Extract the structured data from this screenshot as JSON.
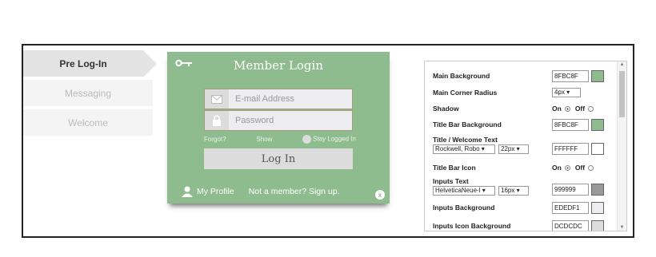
{
  "tabs": [
    {
      "label": "Pre Log-In",
      "active": true
    },
    {
      "label": "Messaging",
      "active": false
    },
    {
      "label": "Welcome",
      "active": false
    }
  ],
  "login": {
    "title": "Member Login",
    "email_placeholder": "E-mail Address",
    "password_placeholder": "Password",
    "forgot": "Forgot?",
    "show": "Show",
    "stay": "Stay Logged In",
    "button": "Log In",
    "profile": "My Profile",
    "signup": "Not a member? Sign up.",
    "close": "x",
    "colors": {
      "background": "#8FBC8F"
    }
  },
  "settings": {
    "main_bg": {
      "label": "Main Background",
      "hex": "8FBC8F",
      "color": "#8FBC8F"
    },
    "corner": {
      "label": "Main Corner Radius",
      "value": "4px"
    },
    "shadow": {
      "label": "Shadow",
      "on": "On",
      "off": "Off",
      "selected": "On"
    },
    "title_bg": {
      "label": "Title Bar Background",
      "hex": "8FBC8F",
      "color": "#8FBC8F"
    },
    "title_text": {
      "label": "Title / Welcome Text",
      "font": "Rockwell, Robo",
      "size": "22px",
      "hex": "FFFFFF",
      "color": "#FFFFFF"
    },
    "title_icon": {
      "label": "Title Bar Icon",
      "on": "On",
      "off": "Off",
      "selected": "On"
    },
    "inputs_text": {
      "label": "Inputs Text",
      "font": "HelveticaNeue-l",
      "size": "16px",
      "hex": "999999",
      "color": "#999999"
    },
    "inputs_bg": {
      "label": "Inputs Background",
      "hex": "EDEDF1",
      "color": "#EDEDF1"
    },
    "inputs_icon_bg": {
      "label": "Inputs Icon Background",
      "hex": "DCDCDC",
      "color": "#DCDCDC"
    }
  }
}
